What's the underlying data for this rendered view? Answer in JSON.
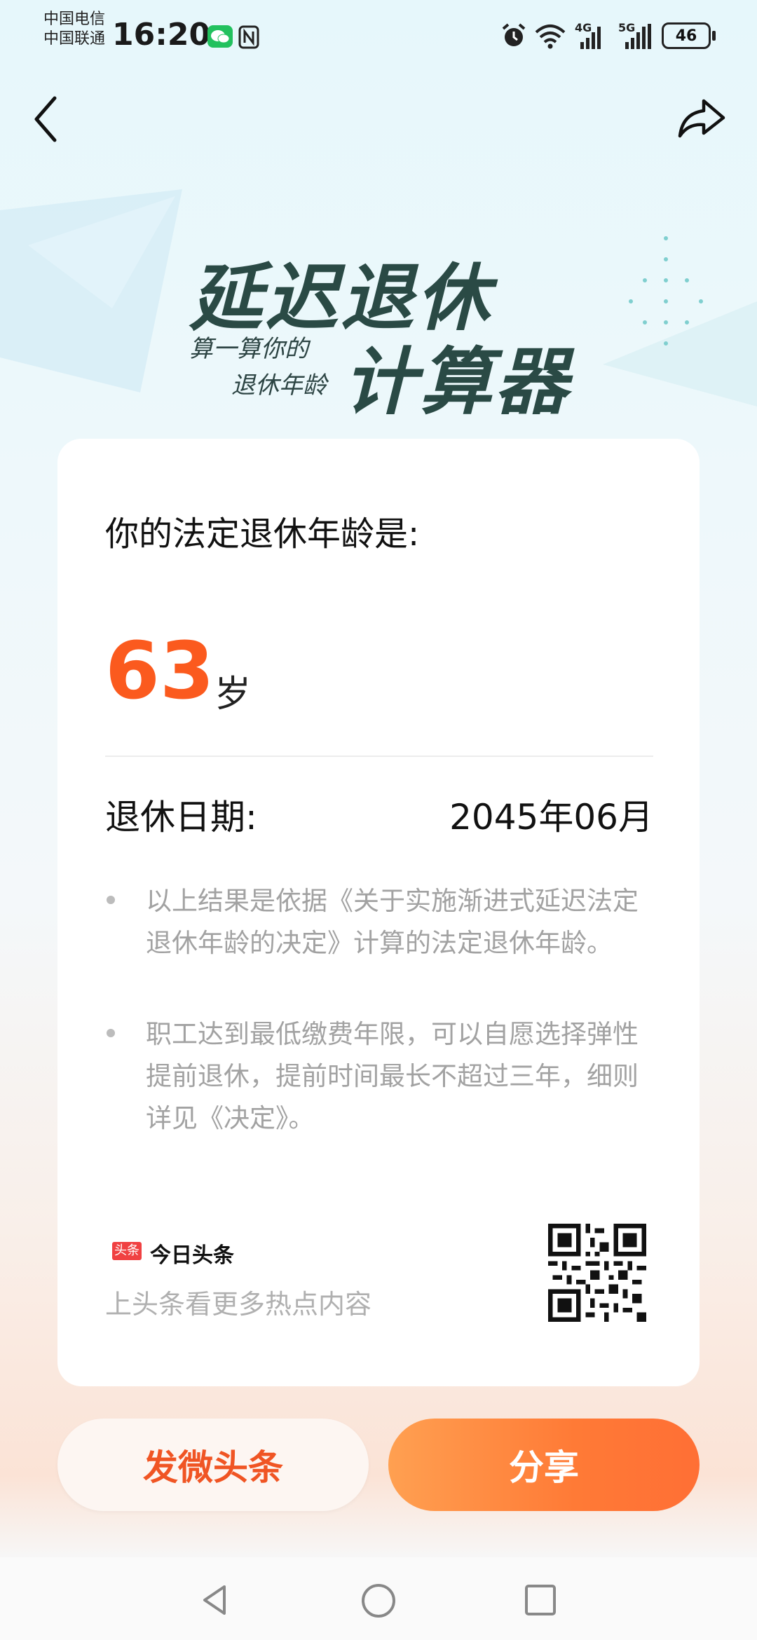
{
  "status_bar": {
    "carrier_1": "中国电信",
    "carrier_2": "中国联通",
    "time": "16:20",
    "signal_1_label": "4G",
    "signal_2_label": "5G",
    "battery": "46"
  },
  "banner": {
    "title": "延迟退休",
    "subtitle_line1": "算一算你的",
    "subtitle_line2": "退休年龄",
    "title_2": "计算器"
  },
  "result": {
    "heading": "你的法定退休年龄是:",
    "age": "63",
    "age_unit": "岁",
    "date_label": "退休日期:",
    "date_value": "2045年06月"
  },
  "notes": [
    "以上结果是依据《关于实施渐进式延迟法定退休年龄的决定》计算的法定退休年龄。",
    "职工达到最低缴费年限，可以自愿选择弹性提前退休，提前时间最长不超过三年，细则详见《决定》。"
  ],
  "brand": {
    "logo_text": "头条",
    "name": "今日头条",
    "slogan": "上头条看更多热点内容"
  },
  "actions": {
    "post_label": "发微头条",
    "share_label": "分享"
  },
  "colors": {
    "accent_orange": "#fb5a1e",
    "share_button": "#ff7a36",
    "banner_text": "#2a4a45"
  }
}
